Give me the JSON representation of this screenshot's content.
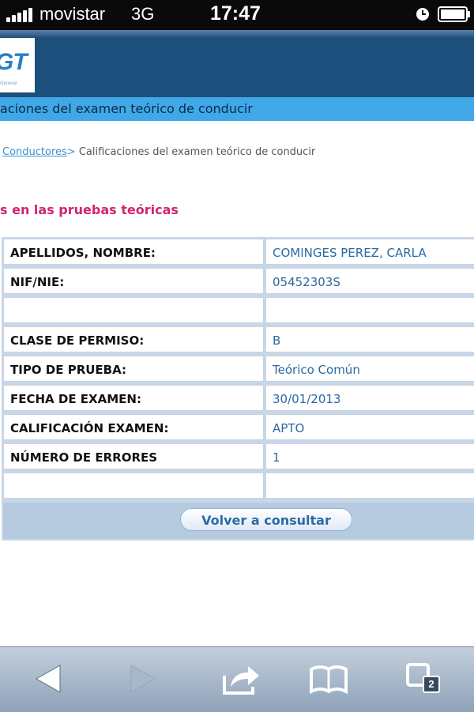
{
  "status_bar": {
    "carrier": "movistar",
    "network": "3G",
    "time": "17:47",
    "icons": [
      "signal-icon",
      "alarm-icon",
      "battery-icon"
    ]
  },
  "header": {
    "logo_text": "GT",
    "logo_subtext": "General",
    "page_title": "aciones del examen teórico de conducir"
  },
  "breadcrumb": {
    "link": "Conductores",
    "separator": ">",
    "current": " Calificaciones del examen teórico de conducir"
  },
  "section_heading": "s en las pruebas teóricas",
  "results": {
    "rows": [
      {
        "label": "APELLIDOS, NOMBRE:",
        "value": "COMINGES PEREZ, CARLA"
      },
      {
        "label": "NIF/NIE:",
        "value": "05452303S"
      },
      {
        "label": "",
        "value": ""
      },
      {
        "label": "CLASE DE PERMISO:",
        "value": "B"
      },
      {
        "label": "TIPO DE PRUEBA:",
        "value": "Teórico Común"
      },
      {
        "label": "FECHA DE EXAMEN:",
        "value": "30/01/2013"
      },
      {
        "label": "CALIFICACIÓN EXAMEN:",
        "value": "APTO"
      },
      {
        "label": "NÚMERO DE ERRORES",
        "value": "1"
      },
      {
        "label": "",
        "value": ""
      }
    ],
    "back_button": "Volver a consultar"
  },
  "toolbar": {
    "buttons": [
      "back-arrow-icon",
      "forward-arrow-icon",
      "share-icon",
      "bookmarks-icon",
      "tabs-icon"
    ],
    "tab_count": "2"
  },
  "colors": {
    "header_blue": "#1d4f7d",
    "title_bar_blue": "#41a8e8",
    "heading_pink": "#d0256d",
    "value_blue": "#2a69a0"
  }
}
